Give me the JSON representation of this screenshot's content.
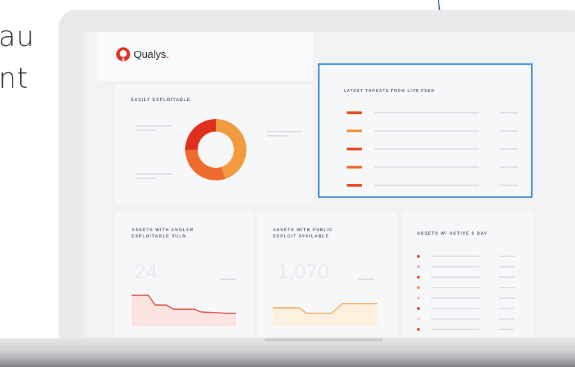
{
  "side_text": {
    "line1": "au",
    "line2": "nt"
  },
  "brand": {
    "name": "Qualys",
    "mark": "."
  },
  "panels": {
    "easily_exploitable": {
      "title": "EASILY EXPLOITABLE",
      "slice_values": [
        45,
        30,
        25
      ],
      "slice_colors": [
        "#f19a3e",
        "#ec6b2d",
        "#df2f1d"
      ]
    },
    "latest_threats": {
      "title": "LATEST THREATS FROM LIVE FEED",
      "bar_colors": [
        "#e6481f",
        "#f0923e",
        "#e6481f",
        "#ec6b2d",
        "#e6481f"
      ]
    },
    "angler": {
      "title_line1": "ASSETS WITH ANGLER",
      "title_line2": "EXPLOITABLE VULN.",
      "value": "24",
      "accent": "#cf3c35"
    },
    "public_exploit": {
      "title_line1": "ASSETS WITH PUBLIC",
      "title_line2": "EXPLOIT AVAILABLE",
      "value": "1,070",
      "accent": "#f0a04b"
    },
    "zero_day": {
      "title": "ASSETS W/ ACTIVE 0 DAY",
      "dot_colors": [
        "#e03a1f",
        "#f3a6a0",
        "#e6481f",
        "#f0923e",
        "#f3b7a6",
        "#e03a1f",
        "#f6c9b6",
        "#e6481f"
      ]
    }
  }
}
